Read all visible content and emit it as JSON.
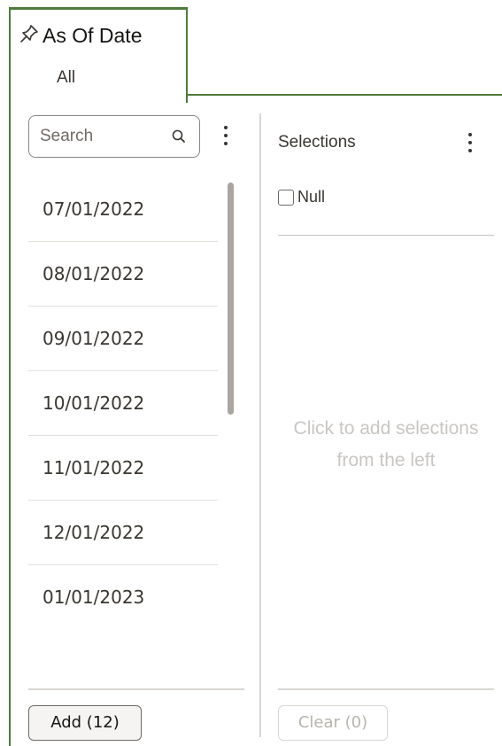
{
  "tab": {
    "title": "As Of Date",
    "subtitle": "All",
    "pin_icon": "pin-icon",
    "accent_color": "#4f7a3a"
  },
  "left_panel": {
    "search": {
      "placeholder": "Search",
      "value": "",
      "icon": "search-icon"
    },
    "menu_icon": "kebab-menu-icon",
    "items": [
      {
        "label": "07/01/2022"
      },
      {
        "label": "08/01/2022"
      },
      {
        "label": "09/01/2022"
      },
      {
        "label": "10/01/2022"
      },
      {
        "label": "11/01/2022"
      },
      {
        "label": "12/01/2022"
      },
      {
        "label": "01/01/2023"
      }
    ],
    "add_button_label": "Add (12)"
  },
  "right_panel": {
    "title": "Selections",
    "menu_icon": "kebab-menu-icon",
    "null_label": "Null",
    "null_checked": false,
    "empty_hint": "Click to add selections from the left",
    "clear_button_label": "Clear (0)"
  }
}
